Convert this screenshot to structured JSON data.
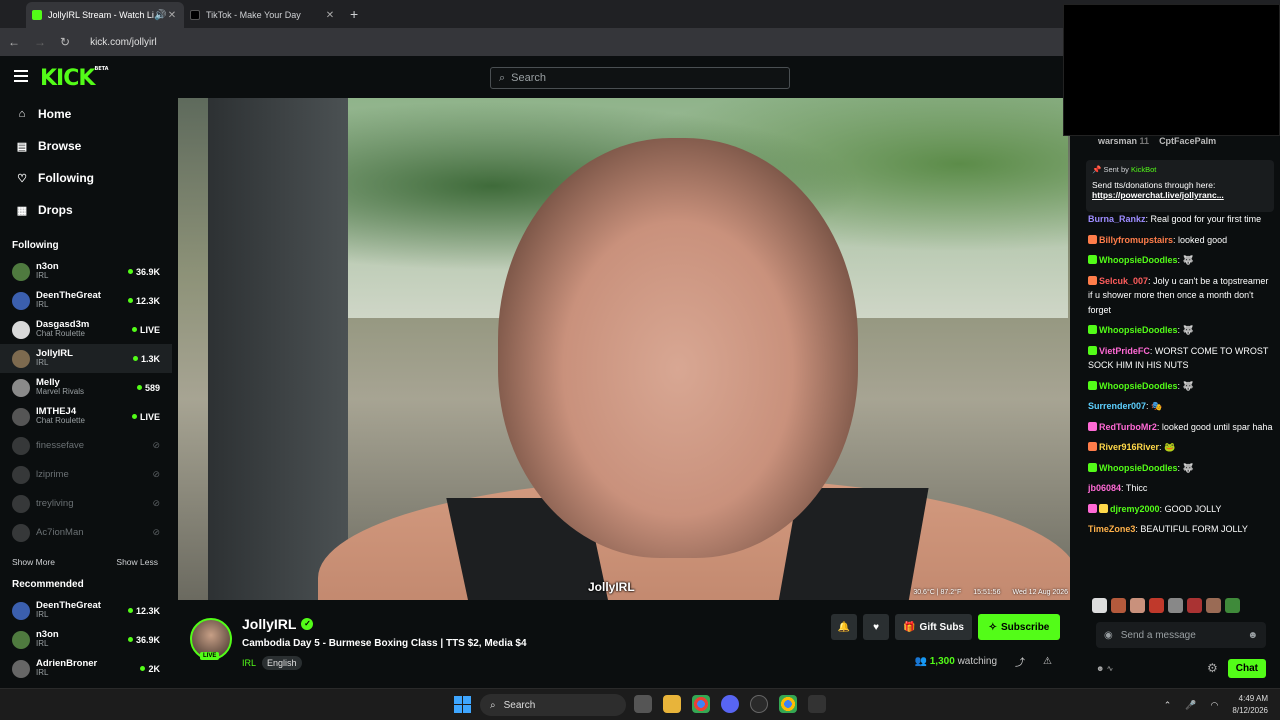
{
  "browser": {
    "tabs": [
      {
        "title": "JollyIRL Stream - Watch Live",
        "active": true
      },
      {
        "title": "TikTok - Make Your Day",
        "active": false
      }
    ],
    "url": "kick.com/jollyirl"
  },
  "header": {
    "logo": "KICK",
    "logo_beta": "BETA",
    "search_placeholder": "Search"
  },
  "sidebar": {
    "nav": [
      {
        "label": "Home",
        "icon": "home-icon"
      },
      {
        "label": "Browse",
        "icon": "browse-icon"
      },
      {
        "label": "Following",
        "icon": "heart-icon"
      },
      {
        "label": "Drops",
        "icon": "drops-icon"
      }
    ],
    "following_title": "Following",
    "following": [
      {
        "name": "n3on",
        "category": "IRL",
        "viewers": "36.9K",
        "live": true
      },
      {
        "name": "DeenTheGreat",
        "category": "IRL",
        "viewers": "12.3K",
        "live": true
      },
      {
        "name": "Dasgasd3m",
        "category": "Chat Roulette",
        "viewers": "LIVE",
        "live": true
      },
      {
        "name": "JollyIRL",
        "category": "IRL",
        "viewers": "1.3K",
        "live": true
      },
      {
        "name": "Melly",
        "category": "Marvel Rivals",
        "viewers": "589",
        "live": true
      },
      {
        "name": "IMTHEJ4",
        "category": "Chat Roulette",
        "viewers": "LIVE",
        "live": true
      },
      {
        "name": "finessefave",
        "category": "",
        "viewers": "",
        "live": false
      },
      {
        "name": "lziprime",
        "category": "",
        "viewers": "",
        "live": false
      },
      {
        "name": "treyliving",
        "category": "",
        "viewers": "",
        "live": false
      },
      {
        "name": "Ac7ionMan",
        "category": "",
        "viewers": "",
        "live": false
      }
    ],
    "show_more": "Show More",
    "show_less": "Show Less",
    "recommended_title": "Recommended",
    "recommended": [
      {
        "name": "DeenTheGreat",
        "category": "IRL",
        "viewers": "12.3K"
      },
      {
        "name": "n3on",
        "category": "IRL",
        "viewers": "36.9K"
      },
      {
        "name": "AdrienBroner",
        "category": "IRL",
        "viewers": "2K"
      }
    ]
  },
  "video": {
    "overlay_name": "JollyIRL",
    "overlay_stats": [
      "30.6°C | 87.2°F",
      "15:51:56",
      "Wed 12 Aug 2026"
    ]
  },
  "stream": {
    "streamer": "JollyIRL",
    "live_badge": "LIVE",
    "title": "Cambodia Day 5 - Burmese Boxing Class | TTS $2, Media $4",
    "category": "IRL",
    "language": "English",
    "gift_subs": "Gift Subs",
    "subscribe": "Subscribe",
    "watching_count": "1,300",
    "watching_label": "watching"
  },
  "chat": {
    "leaderboard": [
      {
        "name": "warsman",
        "count": "11"
      },
      {
        "name": "CptFacePalm",
        "count": ""
      }
    ],
    "pinned": {
      "sent_by": "Sent by",
      "bot": "KickBot",
      "text": "Send tts/donations through here:",
      "link": "https://powerchat.live/jollyranc..."
    },
    "messages": [
      {
        "user": "Burna_Rankz",
        "color": "#9d8cff",
        "text": "Real good for your first time"
      },
      {
        "user": "Billyfromupstairs",
        "color": "#ff7d4a",
        "text": "looked good"
      },
      {
        "user": "WhoopsieDoodles",
        "color": "#53fc18",
        "text": ""
      },
      {
        "user": "Selcuk_007",
        "color": "#ff5d5d",
        "text": "Joly u can't be a topstreamer if u shower more then once a month don't forget"
      },
      {
        "user": "WhoopsieDoodles",
        "color": "#53fc18",
        "text": ""
      },
      {
        "user": "VietPrideFC",
        "color": "#ff6ad5",
        "text": "WORST COME TO WROST SOCK HIM IN HIS NUTS"
      },
      {
        "user": "WhoopsieDoodles",
        "color": "#53fc18",
        "text": ""
      },
      {
        "user": "Surrender007",
        "color": "#5dd0ff",
        "text": ""
      },
      {
        "user": "RedTurboMr2",
        "color": "#ff6ad5",
        "text": "looked good until spar haha"
      },
      {
        "user": "River916River",
        "color": "#ffd84a",
        "text": ""
      },
      {
        "user": "WhoopsieDoodles",
        "color": "#53fc18",
        "text": ""
      },
      {
        "user": "jb06084",
        "color": "#ff6ad5",
        "text": "Thicc"
      },
      {
        "user": "djremy2000",
        "color": "#53fc18",
        "text": "GOOD JOLLY"
      },
      {
        "user": "TimeZone3",
        "color": "#ffb14a",
        "text": "BEAUTIFUL FORM JOLLY"
      }
    ],
    "input_placeholder": "Send a message",
    "chat_button": "Chat"
  },
  "taskbar": {
    "search": "Search",
    "time": "4:49 AM",
    "date": "8/12/2026"
  }
}
